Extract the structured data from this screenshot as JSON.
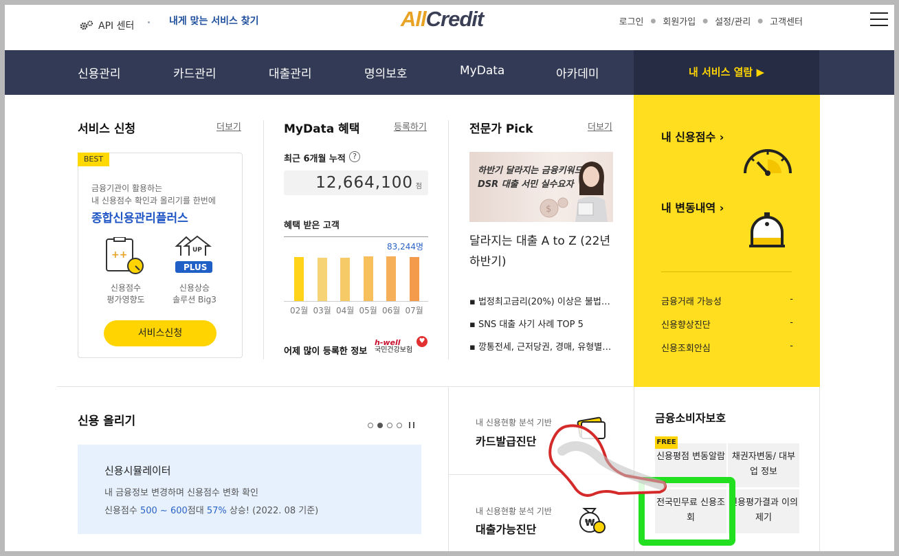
{
  "header": {
    "api_center": "API 센터",
    "find_service": "내게 맞는 서비스 찾기",
    "logo_all": "All",
    "logo_credit": "Credit",
    "util_links": [
      "로그인",
      "회원가입",
      "설정/관리",
      "고객센터"
    ]
  },
  "nav": {
    "items": [
      "신용관리",
      "카드관리",
      "대출관리",
      "명의보호",
      "MyData",
      "아카데미"
    ],
    "my_service": "내 서비스 열람 ▶"
  },
  "service": {
    "title": "서비스 신청",
    "more": "더보기",
    "badge": "BEST",
    "desc1": "금융기관이 활용하는",
    "desc2": "내 신용점수 확인과 올리기를 한번에",
    "headline": "종합신용관리플러스",
    "feature1_line1": "신용점수",
    "feature1_line2": "평가영향도",
    "feature2_line1": "신용상승",
    "feature2_line2": "솔루션 Big3",
    "up_label": "UP",
    "plus_label": "PLUS",
    "apply_button": "서비스신청"
  },
  "mydata": {
    "title": "MyData 혜택",
    "register": "등록하기",
    "cumulative_label": "최근 6개월 누적",
    "help": "?",
    "cumulative_value": "12,664,100",
    "unit": "점",
    "customers_label": "혜택 받은 고객",
    "customers_count": "83,244명",
    "yesterday_label": "어제 많이 등록한 정보",
    "partner_brand": "h-well",
    "partner_name": "국민건강보험"
  },
  "chart_data": {
    "type": "bar",
    "categories": [
      "02월",
      "03월",
      "04월",
      "05월",
      "06월",
      "07월"
    ],
    "values": [
      0.97,
      0.96,
      0.96,
      0.98,
      0.99,
      0.97
    ],
    "colors": [
      "#ffd31a",
      "#f6d374",
      "#f6ca66",
      "#f7c05d",
      "#f5b059",
      "#f49b4b"
    ]
  },
  "expert": {
    "title": "전문가 Pick",
    "more": "더보기",
    "banner_line1": "하반기 달라지는 금융키워드",
    "banner_line2": "DSR 대출 서민 실수요자",
    "headline": "달라지는 대출 A to Z (22년 하반기)",
    "items": [
      "법정최고금리(20%) 이상은 불법…",
      "SNS 대출 사기 사례 TOP 5",
      "깡통전세, 근저당권, 경매, 유형별…"
    ]
  },
  "my_panel": {
    "score": "내 신용점수 ›",
    "changes": "내 변동내역 ›",
    "rows": [
      {
        "label": "금융거래 가능성",
        "value": "-"
      },
      {
        "label": "신용향상진단",
        "value": "-"
      },
      {
        "label": "신용조회안심",
        "value": "-"
      }
    ]
  },
  "raise": {
    "title": "신용 올리기",
    "sim_title": "신용시뮬레이터",
    "sim_desc1": "내 금융정보 변경하며 신용점수 변화 확인",
    "sim_pre": "신용점수 ",
    "sim_range": "500 ~ 600",
    "sim_mid": "점대 ",
    "sim_pct": "57%",
    "sim_post": " 상승! (2022. 08 기준)"
  },
  "diagnosis": {
    "card_sub": "내 신용현황 분석 기반",
    "card_title": "카드발급진단",
    "loan_sub": "내 신용현황 분석 기반",
    "loan_title": "대출가능진단"
  },
  "protect": {
    "title": "금융소비자보호",
    "free": "FREE",
    "box1": "신용평점 변동알람",
    "box2": "채권자변동/ 대부업 정보",
    "box3": "전국민무료 신용조회",
    "box4": "신용평가결과 이의제기"
  }
}
